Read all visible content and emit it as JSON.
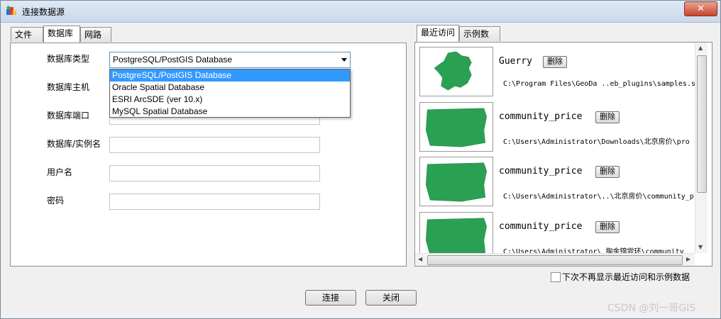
{
  "window": {
    "title": "连接数据源",
    "close_label": "✕"
  },
  "left_tabs": [
    "文件",
    "数据库",
    "网路"
  ],
  "form": {
    "db_type_label": "数据库类型",
    "db_type_value": "PostgreSQL/PostGIS Database",
    "db_type_options": [
      "PostgreSQL/PostGIS Database",
      "Oracle Spatial Database",
      "ESRI ArcSDE (ver 10.x)",
      "MySQL Spatial Database"
    ],
    "host_label": "数据库主机",
    "port_label": "数据库端口",
    "instance_label": "数据库/实例名",
    "user_label": "用户名",
    "password_label": "密码"
  },
  "right_tabs": [
    "最近访问",
    "示例数据"
  ],
  "recent": [
    {
      "name": "Guerry",
      "delete_label": "删除",
      "path": "C:\\Program Files\\GeoDa ..eb_plugins\\samples.s",
      "thumb": "france-map"
    },
    {
      "name": "community_price",
      "delete_label": "删除",
      "path": "C:\\Users\\Administrator\\Downloads\\北京房价\\pro",
      "thumb": "green-polygons"
    },
    {
      "name": "community_price",
      "delete_label": "删除",
      "path": "C:\\Users\\Administrator\\..\\北京房价\\community_p",
      "thumb": "green-polygons"
    },
    {
      "name": "community_price",
      "delete_label": "删除",
      "path": "C:\\Users\\Administrator\\  掏金锦尝环\\community",
      "thumb": "green-polygons"
    }
  ],
  "footer": {
    "checkbox_label": "下次不再显示最近访问和示例数据",
    "connect_label": "连接",
    "close_label": "关闭"
  },
  "watermark": "CSDN @刘一哥GIS",
  "colors": {
    "map_green": "#2aa152",
    "selection": "#3399ff"
  }
}
